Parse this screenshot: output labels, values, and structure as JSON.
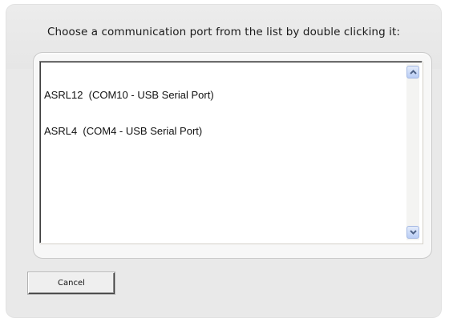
{
  "dialog": {
    "prompt": "Choose a communication port from the list by double clicking it:",
    "ports": [
      "ASRL12  (COM10 - USB Serial Port)",
      "ASRL4  (COM4 - USB Serial Port)"
    ],
    "cancel_label": "Cancel"
  },
  "icons": {
    "scroll_up": "chevron-up-icon",
    "scroll_down": "chevron-down-icon"
  },
  "colors": {
    "dialog_bg": "#e9e9e9",
    "scroll_button": "#b9cdf5",
    "arrow": "#4d6185"
  }
}
